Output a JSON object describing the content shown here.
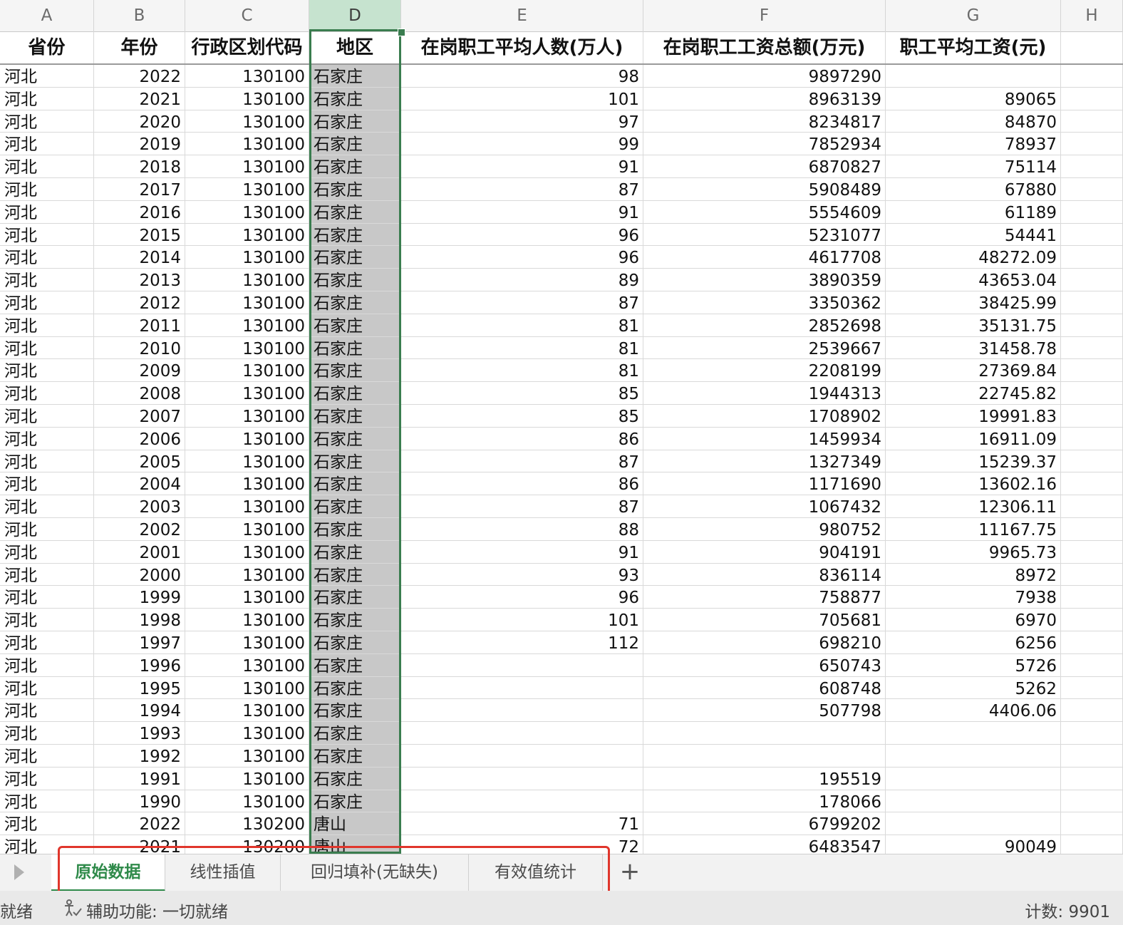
{
  "columns": [
    {
      "letter": "A",
      "header": "省份",
      "align": "txt"
    },
    {
      "letter": "B",
      "header": "年份",
      "align": "num"
    },
    {
      "letter": "C",
      "header": "行政区划代码",
      "align": "num"
    },
    {
      "letter": "D",
      "header": "地区",
      "align": "txt"
    },
    {
      "letter": "E",
      "header": "在岗职工平均人数(万人)",
      "align": "num"
    },
    {
      "letter": "F",
      "header": "在岗职工工资总额(万元)",
      "align": "num"
    },
    {
      "letter": "G",
      "header": "职工平均工资(元)",
      "align": "num"
    },
    {
      "letter": "H",
      "header": "",
      "align": "txt"
    }
  ],
  "selected_column": "D",
  "rows": [
    [
      "河北",
      "2022",
      "130100",
      "石家庄",
      "98",
      "9897290",
      ""
    ],
    [
      "河北",
      "2021",
      "130100",
      "石家庄",
      "101",
      "8963139",
      "89065"
    ],
    [
      "河北",
      "2020",
      "130100",
      "石家庄",
      "97",
      "8234817",
      "84870"
    ],
    [
      "河北",
      "2019",
      "130100",
      "石家庄",
      "99",
      "7852934",
      "78937"
    ],
    [
      "河北",
      "2018",
      "130100",
      "石家庄",
      "91",
      "6870827",
      "75114"
    ],
    [
      "河北",
      "2017",
      "130100",
      "石家庄",
      "87",
      "5908489",
      "67880"
    ],
    [
      "河北",
      "2016",
      "130100",
      "石家庄",
      "91",
      "5554609",
      "61189"
    ],
    [
      "河北",
      "2015",
      "130100",
      "石家庄",
      "96",
      "5231077",
      "54441"
    ],
    [
      "河北",
      "2014",
      "130100",
      "石家庄",
      "96",
      "4617708",
      "48272.09"
    ],
    [
      "河北",
      "2013",
      "130100",
      "石家庄",
      "89",
      "3890359",
      "43653.04"
    ],
    [
      "河北",
      "2012",
      "130100",
      "石家庄",
      "87",
      "3350362",
      "38425.99"
    ],
    [
      "河北",
      "2011",
      "130100",
      "石家庄",
      "81",
      "2852698",
      "35131.75"
    ],
    [
      "河北",
      "2010",
      "130100",
      "石家庄",
      "81",
      "2539667",
      "31458.78"
    ],
    [
      "河北",
      "2009",
      "130100",
      "石家庄",
      "81",
      "2208199",
      "27369.84"
    ],
    [
      "河北",
      "2008",
      "130100",
      "石家庄",
      "85",
      "1944313",
      "22745.82"
    ],
    [
      "河北",
      "2007",
      "130100",
      "石家庄",
      "85",
      "1708902",
      "19991.83"
    ],
    [
      "河北",
      "2006",
      "130100",
      "石家庄",
      "86",
      "1459934",
      "16911.09"
    ],
    [
      "河北",
      "2005",
      "130100",
      "石家庄",
      "87",
      "1327349",
      "15239.37"
    ],
    [
      "河北",
      "2004",
      "130100",
      "石家庄",
      "86",
      "1171690",
      "13602.16"
    ],
    [
      "河北",
      "2003",
      "130100",
      "石家庄",
      "87",
      "1067432",
      "12306.11"
    ],
    [
      "河北",
      "2002",
      "130100",
      "石家庄",
      "88",
      "980752",
      "11167.75"
    ],
    [
      "河北",
      "2001",
      "130100",
      "石家庄",
      "91",
      "904191",
      "9965.73"
    ],
    [
      "河北",
      "2000",
      "130100",
      "石家庄",
      "93",
      "836114",
      "8972"
    ],
    [
      "河北",
      "1999",
      "130100",
      "石家庄",
      "96",
      "758877",
      "7938"
    ],
    [
      "河北",
      "1998",
      "130100",
      "石家庄",
      "101",
      "705681",
      "6970"
    ],
    [
      "河北",
      "1997",
      "130100",
      "石家庄",
      "112",
      "698210",
      "6256"
    ],
    [
      "河北",
      "1996",
      "130100",
      "石家庄",
      "",
      "650743",
      "5726"
    ],
    [
      "河北",
      "1995",
      "130100",
      "石家庄",
      "",
      "608748",
      "5262"
    ],
    [
      "河北",
      "1994",
      "130100",
      "石家庄",
      "",
      "507798",
      "4406.06"
    ],
    [
      "河北",
      "1993",
      "130100",
      "石家庄",
      "",
      "",
      ""
    ],
    [
      "河北",
      "1992",
      "130100",
      "石家庄",
      "",
      "",
      ""
    ],
    [
      "河北",
      "1991",
      "130100",
      "石家庄",
      "",
      "195519",
      ""
    ],
    [
      "河北",
      "1990",
      "130100",
      "石家庄",
      "",
      "178066",
      ""
    ],
    [
      "河北",
      "2022",
      "130200",
      "唐山",
      "71",
      "6799202",
      ""
    ],
    [
      "河北",
      "2021",
      "130200",
      "唐山",
      "72",
      "6483547",
      "90049"
    ]
  ],
  "sheet_tabs": [
    {
      "label": "原始数据",
      "active": true
    },
    {
      "label": "线性插值",
      "active": false
    },
    {
      "label": "回归填补(无缺失)",
      "active": false
    },
    {
      "label": "有效值统计",
      "active": false
    }
  ],
  "add_sheet_label": "+",
  "status": {
    "ready": "就绪",
    "accessibility": "辅助功能: 一切就绪",
    "count": "计数: 9901"
  },
  "colors": {
    "selection_green": "#3a7d4f",
    "active_tab": "#2f8a4a",
    "highlight_box": "#e0362c",
    "selected_fill": "#c8c8c8"
  }
}
